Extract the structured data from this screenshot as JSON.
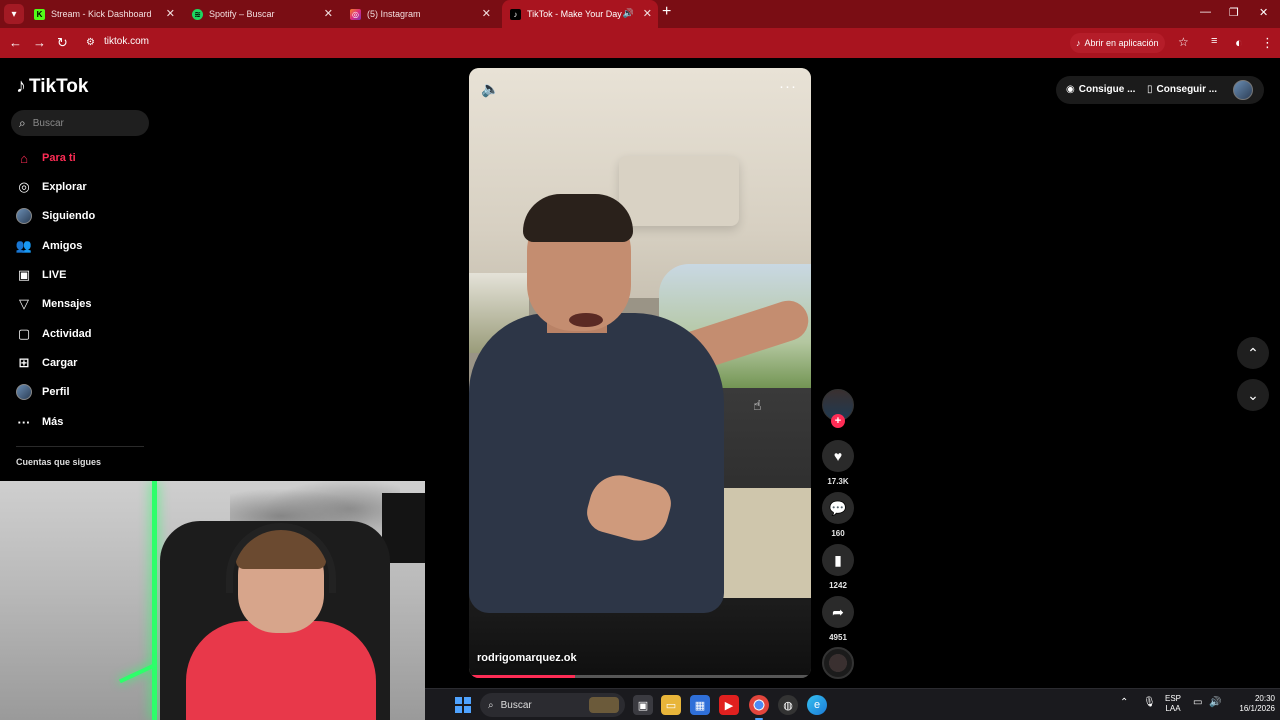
{
  "browser": {
    "tabs": [
      {
        "title": "Stream - Kick Dashboard",
        "icon": "kick-icon",
        "color": "#53fc18"
      },
      {
        "title": "Spotify – Buscar",
        "icon": "spotify-icon",
        "color": "#1ed760"
      },
      {
        "title": "(5) Instagram",
        "icon": "instagram-icon",
        "color": "#e1306c"
      },
      {
        "title": "TikTok - Make Your Day",
        "icon": "tiktok-icon",
        "color": "#000000",
        "active": true
      }
    ],
    "url": "tiktok.com",
    "open_in_app_label": "Abrir en aplicación"
  },
  "sidebar": {
    "logo_text": "TikTok",
    "search_placeholder": "Buscar",
    "items": [
      {
        "label": "Para ti",
        "icon": "home-icon",
        "active": true
      },
      {
        "label": "Explorar",
        "icon": "compass-icon"
      },
      {
        "label": "Siguiendo",
        "icon": "avatar-icon"
      },
      {
        "label": "Amigos",
        "icon": "friends-icon"
      },
      {
        "label": "LIVE",
        "icon": "live-icon"
      },
      {
        "label": "Mensajes",
        "icon": "messages-icon"
      },
      {
        "label": "Actividad",
        "icon": "activity-icon"
      },
      {
        "label": "Cargar",
        "icon": "upload-icon"
      },
      {
        "label": "Perfil",
        "icon": "profile-avatar-icon"
      },
      {
        "label": "Más",
        "icon": "more-icon"
      }
    ],
    "following_title": "Cuentas que sigues"
  },
  "video": {
    "author": "rodrigomarquez.ok",
    "progress": 0.31
  },
  "actions": {
    "likes": "17.3K",
    "comments": "160",
    "saves": "1242",
    "shares": "4951"
  },
  "top_right": {
    "coins_label": "Consigue ...",
    "app_label": "Conseguir ..."
  },
  "taskbar": {
    "search_label": "Buscar",
    "lang_line1": "ESP",
    "lang_line2": "LAA",
    "time": "20:30",
    "date": "16/1/2026"
  },
  "colors": {
    "accent": "#fe2c55",
    "browser_frame": "#a9141f"
  }
}
